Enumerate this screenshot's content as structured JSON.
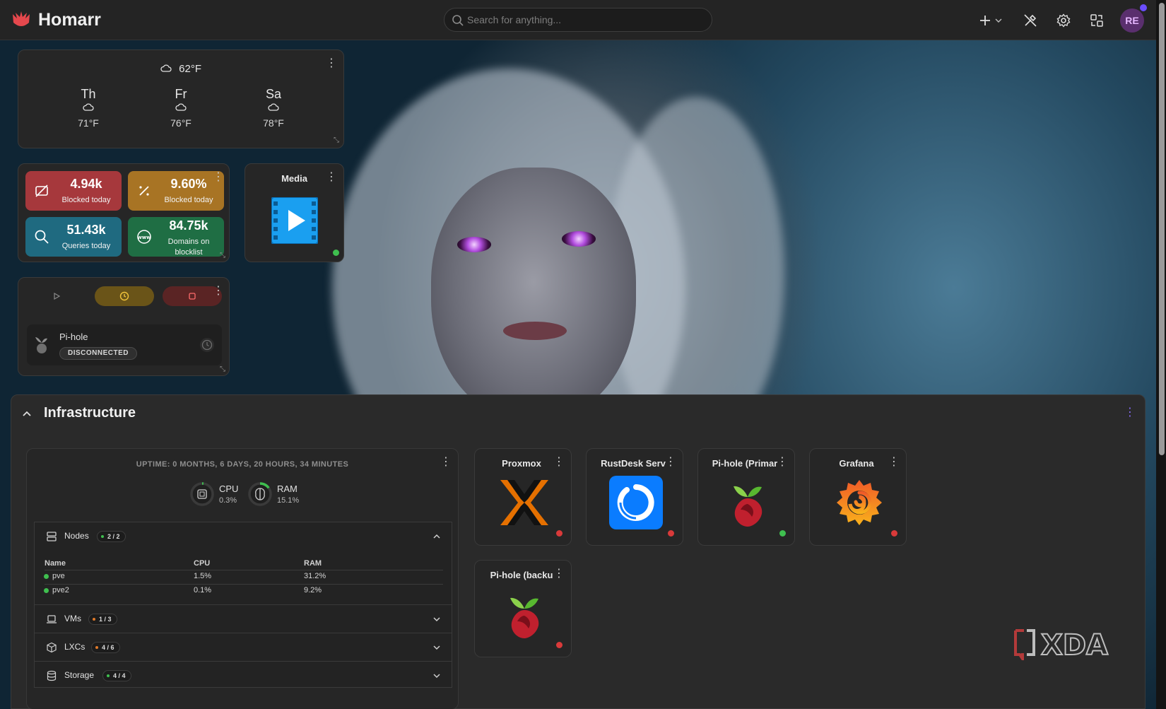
{
  "app": {
    "name": "Homarr"
  },
  "search": {
    "placeholder": "Search for anything..."
  },
  "user": {
    "initials": "RE"
  },
  "weather": {
    "current": "62°F",
    "forecast": [
      {
        "day": "Th",
        "temp": "71°F"
      },
      {
        "day": "Fr",
        "temp": "76°F"
      },
      {
        "day": "Sa",
        "temp": "78°F"
      }
    ]
  },
  "pihole_stats": [
    {
      "value": "4.94k",
      "label": "Blocked today",
      "color": "#a6383c"
    },
    {
      "value": "9.60%",
      "label": "Blocked today",
      "color": "#a87424"
    },
    {
      "value": "51.43k",
      "label": "Queries today",
      "color": "#1f6a80"
    },
    {
      "value": "84.75k",
      "label": "Domains on blocklist",
      "color": "#1f6e44"
    }
  ],
  "media": {
    "title": "Media"
  },
  "control": {
    "service_name": "Pi-hole",
    "status": "DISCONNECTED"
  },
  "section": {
    "title": "Infrastructure"
  },
  "proxmox": {
    "uptime": "UPTIME: 0 MONTHS, 6 DAYS, 20 HOURS, 34 MINUTES",
    "cpu": {
      "label": "CPU",
      "value": "0.3%",
      "fraction": 0.003
    },
    "ram": {
      "label": "RAM",
      "value": "15.1%",
      "fraction": 0.151
    },
    "nodes": {
      "label": "Nodes",
      "count": "2 / 2"
    },
    "columns": [
      "Name",
      "CPU",
      "RAM"
    ],
    "rows": [
      {
        "name": "pve",
        "cpu": "1.5%",
        "ram": "31.2%"
      },
      {
        "name": "pve2",
        "cpu": "0.1%",
        "ram": "9.2%"
      }
    ],
    "vms": {
      "label": "VMs",
      "count": "1 / 3"
    },
    "lxcs": {
      "label": "LXCs",
      "count": "4 / 6"
    },
    "storage": {
      "label": "Storage",
      "count": "4 / 4"
    }
  },
  "apps": [
    {
      "name": "Proxmox",
      "status_color": "#d93a3a"
    },
    {
      "name": "RustDesk Serv",
      "status_color": "#d93a3a"
    },
    {
      "name": "Pi-hole (Primar",
      "status_color": "#3fbf4f"
    },
    {
      "name": "Grafana",
      "status_color": "#d93a3a"
    },
    {
      "name": "Pi-hole (backu",
      "status_color": "#d93a3a"
    }
  ],
  "watermark": {
    "text": "XDA"
  },
  "colors": {
    "ok": "#3fbf4f",
    "error": "#d93a3a",
    "warn": "#e07a2a"
  }
}
